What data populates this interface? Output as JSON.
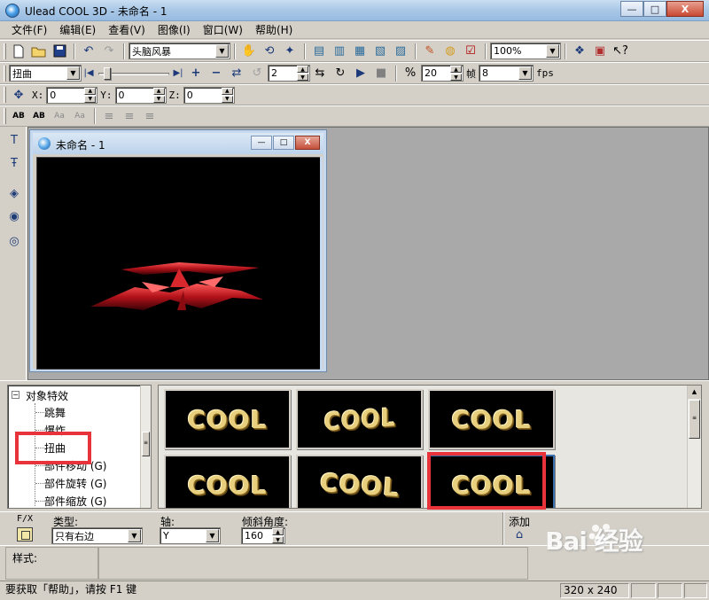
{
  "window": {
    "title": "Ulead COOL 3D - 未命名 - 1",
    "minimize": "—",
    "maximize": "□",
    "close": "X"
  },
  "menu": [
    "文件(F)",
    "编辑(E)",
    "查看(V)",
    "图像(I)",
    "窗口(W)",
    "帮助(H)"
  ],
  "toolbar1": {
    "font_combo": "头脑风暴",
    "zoom_combo": "100%"
  },
  "toolbar2": {
    "effect_combo": "扭曲",
    "frame_spin": "2",
    "speed_spin": "20",
    "frame_label": "帧",
    "fps_combo": "8",
    "fps_label": "fps"
  },
  "toolbar3": {
    "x_label": "X:",
    "x_value": "0",
    "y_label": "Y:",
    "y_value": "0",
    "z_label": "Z:",
    "z_value": "0"
  },
  "toolbar4": {
    "text_btn1": "AB",
    "text_btn2": "AB",
    "text_btn3": "Aa",
    "text_btn4": "Aa"
  },
  "document": {
    "title": "未命名 - 1",
    "min": "—",
    "max": "□",
    "close": "X"
  },
  "tree": {
    "root": "对象特效",
    "items": [
      "跳舞",
      "爆炸",
      "扭曲",
      "部件移动 (G)",
      "部件旋转 (G)",
      "部件缩放 (G)"
    ],
    "expand_sign": "−"
  },
  "gallery": {
    "thumbs": [
      "COOL",
      "COOL",
      "COOL",
      "COOL",
      "COOL",
      "COOL"
    ]
  },
  "fx": {
    "fx_label": "F/X",
    "type_label": "类型:",
    "type_value": "只有右边",
    "axis_label": "轴:",
    "axis_value": "Y",
    "angle_label": "倾斜角度:",
    "angle_value": "160",
    "add_label": "添加"
  },
  "style": {
    "label": "样式:"
  },
  "status": {
    "help": "要获取「帮助」，请按 F1 键",
    "size": "320 x 240"
  },
  "watermark": "Bai  经验",
  "colors": {
    "highlight": "#e8333b",
    "gold_text": "#e7cf7e"
  }
}
